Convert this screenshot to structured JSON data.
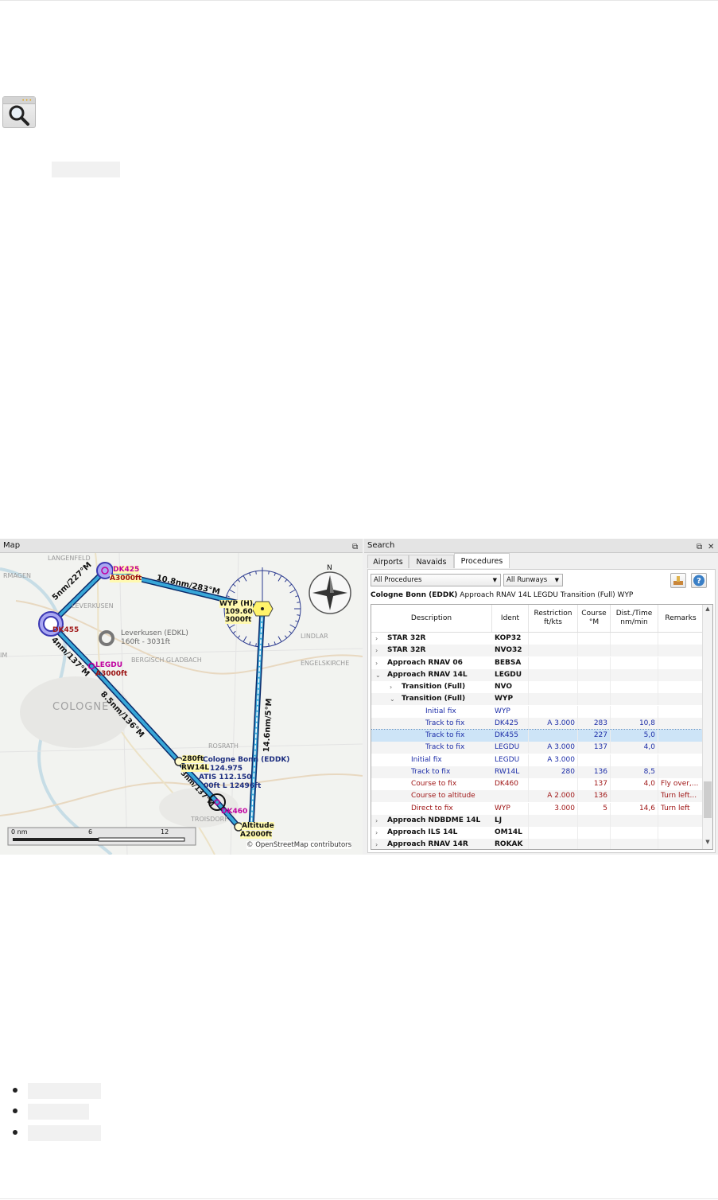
{
  "map": {
    "title": "Map",
    "town_labels": [
      "LANGENFELD",
      "LEVERKUSEN",
      "BERGISCH GLADBACH",
      "COLOGNE",
      "ROSRATH",
      "TROISDORF",
      "LINDLAR",
      "ENGELSKIRCHE",
      "RMAGEN",
      "IM"
    ],
    "waypoints": {
      "dk425_name": "DK425",
      "dk425_alt": "A3000ft",
      "dk455_name": "DK455",
      "legdu_name": "LEGDU",
      "legdu_alt": "A3000ft",
      "wyp_name": "WYP (H)",
      "wyp_freq": "109.60",
      "wyp_alt": "3000ft",
      "rw14l_alt": "280ft",
      "rw14l_name": "RW14L",
      "dk460_name": "DK460",
      "altitude_label": "Altitude",
      "altitude_value": "A2000ft"
    },
    "legs": {
      "leg1": "5nm/227°M",
      "leg2": "10.8nm/283°M",
      "leg3": "4nm/137°M",
      "leg4": "8.5nm/136°M",
      "leg5": "14.6nm/5°M",
      "leg6": "3nm/137°M"
    },
    "airport": {
      "name": "Leverkusen (EDKL)",
      "elev": "160ft - 3031ft",
      "eddk_name": "Cologne Bonn (EDDK)",
      "eddk_freq": "124.975",
      "eddk_atis": "ATIS 112.150",
      "eddk_rwy": "00ft L 12496ft"
    },
    "compass_n": "N",
    "scale": {
      "l0": "0 nm",
      "l6": "6",
      "l12": "12"
    },
    "attribution": "© OpenStreetMap contributors"
  },
  "search": {
    "title": "Search",
    "tabs": [
      "Airports",
      "Navaids",
      "Procedures"
    ],
    "active_tab": "Procedures",
    "filter_procedures": "All Procedures",
    "filter_runways": "All Runways",
    "heading_bold": "Cologne Bonn (EDDK)",
    "heading_rest": " Approach RNAV 14L LEGDU Transition (Full) WYP",
    "columns": {
      "description": "Description",
      "ident": "Ident",
      "restriction_1": "Restriction",
      "restriction_2": "ft/kts",
      "course_1": "Course",
      "course_2": "°M",
      "dist_1": "Dist./Time",
      "dist_2": "nm/min",
      "remarks": "Remarks"
    },
    "rows": [
      {
        "desc": "STAR 32R",
        "ident": "KOP32",
        "restr": "",
        "course": "",
        "dist": "",
        "remarks": "",
        "level": 0,
        "bold": true,
        "expander": "›",
        "color": "#111"
      },
      {
        "desc": "STAR 32R",
        "ident": "NVO32",
        "restr": "",
        "course": "",
        "dist": "",
        "remarks": "",
        "level": 0,
        "bold": true,
        "expander": "›",
        "color": "#111"
      },
      {
        "desc": "Approach RNAV 06",
        "ident": "BEBSA",
        "restr": "",
        "course": "",
        "dist": "",
        "remarks": "",
        "level": 0,
        "bold": true,
        "expander": "›",
        "color": "#111"
      },
      {
        "desc": "Approach RNAV 14L",
        "ident": "LEGDU",
        "restr": "",
        "course": "",
        "dist": "",
        "remarks": "",
        "level": 0,
        "bold": true,
        "expander": "⌄",
        "color": "#111"
      },
      {
        "desc": "Transition (Full)",
        "ident": "NVO",
        "restr": "",
        "course": "",
        "dist": "",
        "remarks": "",
        "level": 1,
        "bold": true,
        "expander": "›",
        "color": "#111"
      },
      {
        "desc": "Transition (Full)",
        "ident": "WYP",
        "restr": "",
        "course": "",
        "dist": "",
        "remarks": "",
        "level": 1,
        "bold": true,
        "expander": "⌄",
        "color": "#111"
      },
      {
        "desc": "Initial fix",
        "ident": "WYP",
        "restr": "",
        "course": "",
        "dist": "",
        "remarks": "",
        "level": 2,
        "bold": false,
        "expander": "",
        "color": "#1d2ea8"
      },
      {
        "desc": "Track to fix",
        "ident": "DK425",
        "restr": "A 3.000",
        "course": "283",
        "dist": "10,8",
        "remarks": "",
        "level": 2,
        "bold": false,
        "expander": "",
        "color": "#1d2ea8"
      },
      {
        "desc": "Track to fix",
        "ident": "DK455",
        "restr": "",
        "course": "227",
        "dist": "5,0",
        "remarks": "",
        "level": 2,
        "bold": false,
        "expander": "",
        "color": "#1d2ea8"
      },
      {
        "desc": "Track to fix",
        "ident": "LEGDU",
        "restr": "A 3.000",
        "course": "137",
        "dist": "4,0",
        "remarks": "",
        "level": 2,
        "bold": false,
        "expander": "",
        "color": "#1d2ea8"
      },
      {
        "desc": "Initial fix",
        "ident": "LEGDU",
        "restr": "A 3.000",
        "course": "",
        "dist": "",
        "remarks": "",
        "level": 1.5,
        "bold": false,
        "expander": "",
        "color": "#1d2ea8"
      },
      {
        "desc": "Track to fix",
        "ident": "RW14L",
        "restr": "280",
        "course": "136",
        "dist": "8,5",
        "remarks": "",
        "level": 1.5,
        "bold": false,
        "expander": "",
        "color": "#1d2ea8"
      },
      {
        "desc": "Course to fix",
        "ident": "DK460",
        "restr": "",
        "course": "137",
        "dist": "4,0",
        "remarks": "Fly over,...",
        "level": 1.5,
        "bold": false,
        "expander": "",
        "color": "#a01818"
      },
      {
        "desc": "Course to altitude",
        "ident": "",
        "restr": "A 2.000",
        "course": "136",
        "dist": "",
        "remarks": "Turn left...",
        "level": 1.5,
        "bold": false,
        "expander": "",
        "color": "#a01818"
      },
      {
        "desc": "Direct to fix",
        "ident": "WYP",
        "restr": "3.000",
        "course": "5",
        "dist": "14,6",
        "remarks": "Turn left",
        "level": 1.5,
        "bold": false,
        "expander": "",
        "color": "#a01818"
      },
      {
        "desc": "Approach NDBDME 14L",
        "ident": "LJ",
        "restr": "",
        "course": "",
        "dist": "",
        "remarks": "",
        "level": 0,
        "bold": true,
        "expander": "›",
        "color": "#111"
      },
      {
        "desc": "Approach ILS 14L",
        "ident": "OM14L",
        "restr": "",
        "course": "",
        "dist": "",
        "remarks": "",
        "level": 0,
        "bold": true,
        "expander": "›",
        "color": "#111"
      },
      {
        "desc": "Approach RNAV 14R",
        "ident": "ROKAK",
        "restr": "",
        "course": "",
        "dist": "",
        "remarks": "",
        "level": 0,
        "bold": true,
        "expander": "›",
        "color": "#111"
      }
    ],
    "selected_row": 8
  }
}
